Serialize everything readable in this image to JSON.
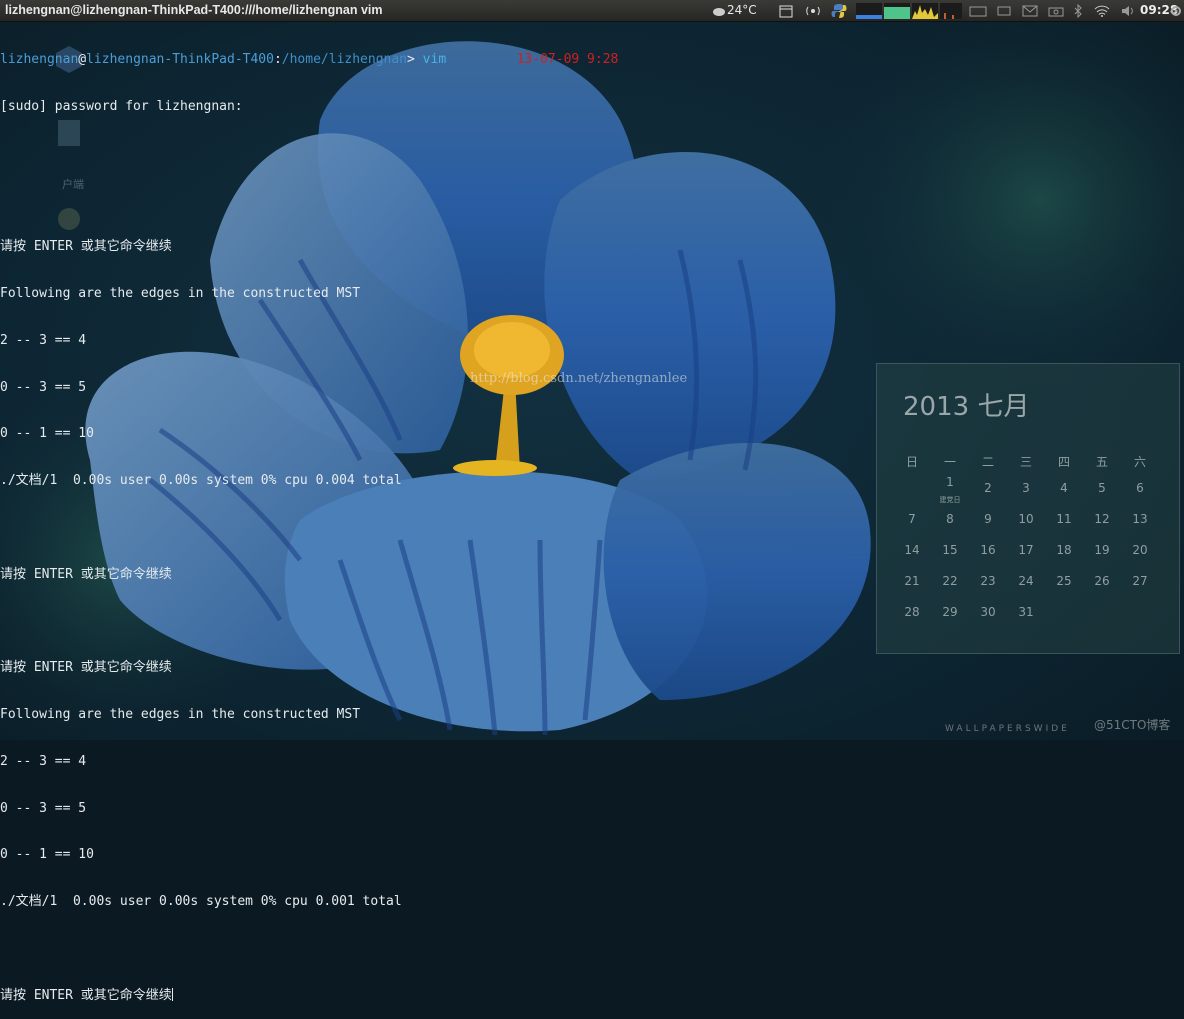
{
  "window": {
    "title": "lizhengnan@lizhengnan-ThinkPad-T400:///home/lizhengnan vim"
  },
  "panel": {
    "weather": "24°C",
    "clock": "09:28",
    "icons": [
      "weather-icon",
      "calendar-icon",
      "network-icon",
      "python-icon",
      "cpu-graph-icon",
      "mem-graph-icon",
      "netload-graph-icon",
      "disk-graph-icon",
      "keyboard-icon",
      "battery-icon",
      "mail-icon",
      "camera-icon",
      "bluetooth-icon",
      "wifi-icon",
      "volume-icon",
      "settings-gear-icon"
    ],
    "colors": {
      "mem_graph": "#4fc48a",
      "cpu_graph": "#3b7fe0",
      "netload_graph": "#e2c83a"
    }
  },
  "terminal": {
    "prompt": {
      "user": "lizhengnan",
      "at": "@",
      "host": "lizhengnan-ThinkPad-T400",
      "colon": ":",
      "path": "/home/lizhengnan",
      "gt": ">",
      "cmd": "vim",
      "time": "13-07-09 9:28"
    },
    "lines": [
      "[sudo] password for lizhengnan:",
      "",
      "",
      "请按 ENTER 或其它命令继续",
      "Following are the edges in the constructed MST",
      "2 -- 3 == 4",
      "0 -- 3 == 5",
      "0 -- 1 == 10",
      "./文档/1  0.00s user 0.00s system 0% cpu 0.004 total",
      "",
      "请按 ENTER 或其它命令继续",
      "",
      "请按 ENTER 或其它命令继续",
      "Following are the edges in the constructed MST",
      "2 -- 3 == 4",
      "0 -- 3 == 5",
      "0 -- 1 == 10",
      "./文档/1  0.00s user 0.00s system 0% cpu 0.001 total",
      "",
      "请按 ENTER 或其它命令继续"
    ]
  },
  "watermark": "http://blog.csdn.net/zhengnanlee",
  "desktop_ghosts": [
    "户端"
  ],
  "calendar": {
    "year": "2013",
    "month": "七月",
    "weekdays": [
      "日",
      "一",
      "二",
      "三",
      "四",
      "五",
      "六"
    ],
    "rows": [
      [
        "",
        "1",
        "2",
        "3",
        "4",
        "5",
        "6"
      ],
      [
        "7",
        "8",
        "9",
        "10",
        "11",
        "12",
        "13"
      ],
      [
        "14",
        "15",
        "16",
        "17",
        "18",
        "19",
        "20"
      ],
      [
        "21",
        "22",
        "23",
        "24",
        "25",
        "26",
        "27"
      ],
      [
        "28",
        "29",
        "30",
        "31",
        "",
        "",
        ""
      ]
    ],
    "note_day": "1",
    "note": "建党日"
  },
  "footer": {
    "wallpaper_brand": "WALLPAPERSWIDE",
    "site_mark": "@51CTO博客"
  }
}
